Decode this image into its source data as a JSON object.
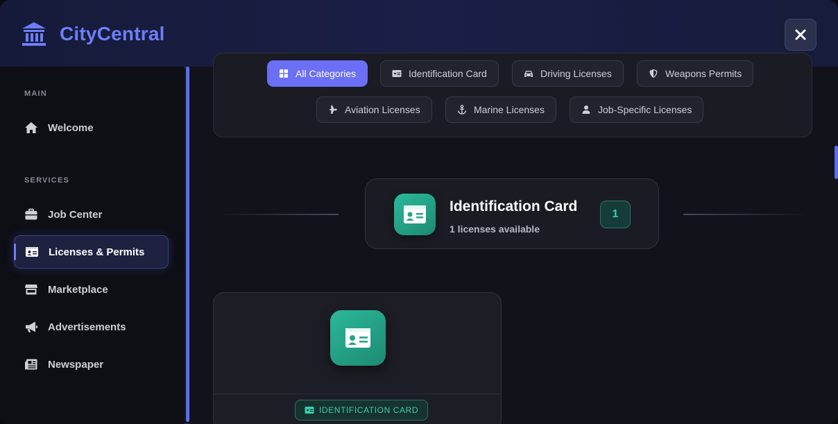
{
  "app": {
    "title": "CityCentral"
  },
  "sidebar": {
    "sections": [
      {
        "label": "MAIN",
        "items": [
          {
            "label": "Welcome",
            "icon": "home-icon"
          }
        ]
      },
      {
        "label": "SERVICES",
        "items": [
          {
            "label": "Job Center",
            "icon": "briefcase-icon"
          },
          {
            "label": "Licenses & Permits",
            "icon": "id-card-icon",
            "active": true
          },
          {
            "label": "Marketplace",
            "icon": "store-icon"
          },
          {
            "label": "Advertisements",
            "icon": "megaphone-icon"
          },
          {
            "label": "Newspaper",
            "icon": "newspaper-icon"
          }
        ]
      }
    ]
  },
  "filters": [
    {
      "label": "All Categories",
      "icon": "grid-icon",
      "active": true
    },
    {
      "label": "Identification Card",
      "icon": "id-card-icon"
    },
    {
      "label": "Driving Licenses",
      "icon": "car-icon"
    },
    {
      "label": "Weapons Permits",
      "icon": "shield-icon"
    },
    {
      "label": "Aviation Licenses",
      "icon": "plane-icon"
    },
    {
      "label": "Marine Licenses",
      "icon": "anchor-icon"
    },
    {
      "label": "Job-Specific Licenses",
      "icon": "user-icon"
    }
  ],
  "category": {
    "title": "Identification Card",
    "subtitle": "1 licenses available",
    "count": "1"
  },
  "item": {
    "badge": "IDENTIFICATION CARD"
  },
  "colors": {
    "accent": "#6d7ef7",
    "teal": "#2bb89a",
    "chip_active": "#6b6ff5"
  }
}
